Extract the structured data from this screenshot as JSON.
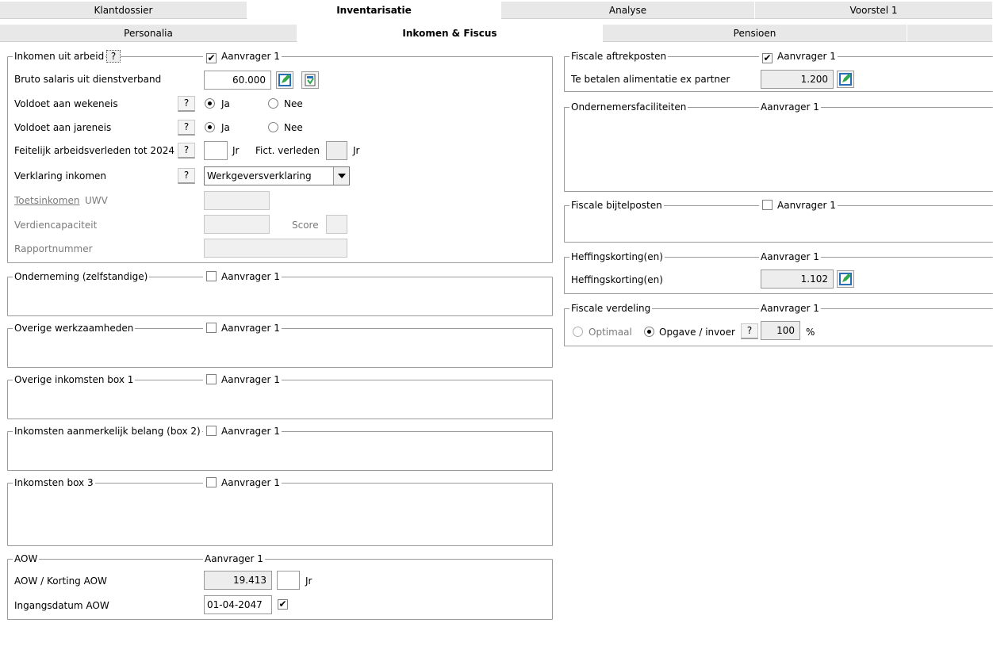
{
  "tabs_top": [
    "Klantdossier",
    "Inventarisatie",
    "Analyse",
    "Voorstel 1"
  ],
  "tabs_sub": [
    "Personalia",
    "Inkomen & Fiscus",
    "Pensioen"
  ],
  "left": {
    "arbeid": {
      "title": "Inkomen uit arbeid",
      "q": "?",
      "applicant": "Aanvrager 1",
      "bruto_label": "Bruto salaris uit dienstverband",
      "bruto_value": "60.000",
      "wekeneis_label": "Voldoet aan wekeneis",
      "jareneis_label": "Voldoet aan jareneis",
      "ja": "Ja",
      "nee": "Nee",
      "q_btn": "?",
      "feitelijk_label": "Feitelijk arbeidsverleden tot 2024",
      "jr": "Jr",
      "fict_label": "Fict. verleden",
      "verklaring_label": "Verklaring inkomen",
      "verklaring_value": "Werkgeversverklaring",
      "toets_label": "Toetsinkomen",
      "uwv_label": "UWV",
      "verdien_label": "Verdiencapaciteit",
      "score_label": "Score",
      "rapport_label": "Rapportnummer"
    },
    "onderneming": {
      "title": "Onderneming (zelfstandige)",
      "applicant": "Aanvrager 1"
    },
    "overige_werk": {
      "title": "Overige werkzaamheden",
      "applicant": "Aanvrager 1"
    },
    "overige_box1": {
      "title": "Overige inkomsten box 1",
      "applicant": "Aanvrager 1"
    },
    "box2": {
      "title": "Inkomsten aanmerkelijk belang (box 2)",
      "applicant": "Aanvrager 1"
    },
    "box3": {
      "title": "Inkomsten box 3",
      "applicant": "Aanvrager 1"
    },
    "aow": {
      "title": "AOW",
      "applicant": "Aanvrager 1",
      "korting_label": "AOW / Korting AOW",
      "korting_value": "19.413",
      "jr": "Jr",
      "datum_label": "Ingangsdatum AOW",
      "datum_value": "01-04-2047"
    }
  },
  "right": {
    "aftrek": {
      "title": "Fiscale aftrekposten",
      "applicant": "Aanvrager 1",
      "alimentatie_label": "Te betalen alimentatie ex partner",
      "alimentatie_value": "1.200"
    },
    "ondernemers": {
      "title": "Ondernemersfaciliteiten",
      "applicant": "Aanvrager 1"
    },
    "bijtel": {
      "title": "Fiscale bijtelposten",
      "applicant": "Aanvrager 1"
    },
    "heffing": {
      "title": "Heffingskorting(en)",
      "applicant": "Aanvrager 1",
      "label": "Heffingskorting(en)",
      "value": "1.102"
    },
    "verdeling": {
      "title": "Fiscale verdeling",
      "applicant": "Aanvrager 1",
      "optimaal": "Optimaal",
      "opgave": "Opgave / invoer",
      "q": "?",
      "value": "100",
      "pct": "%"
    }
  }
}
